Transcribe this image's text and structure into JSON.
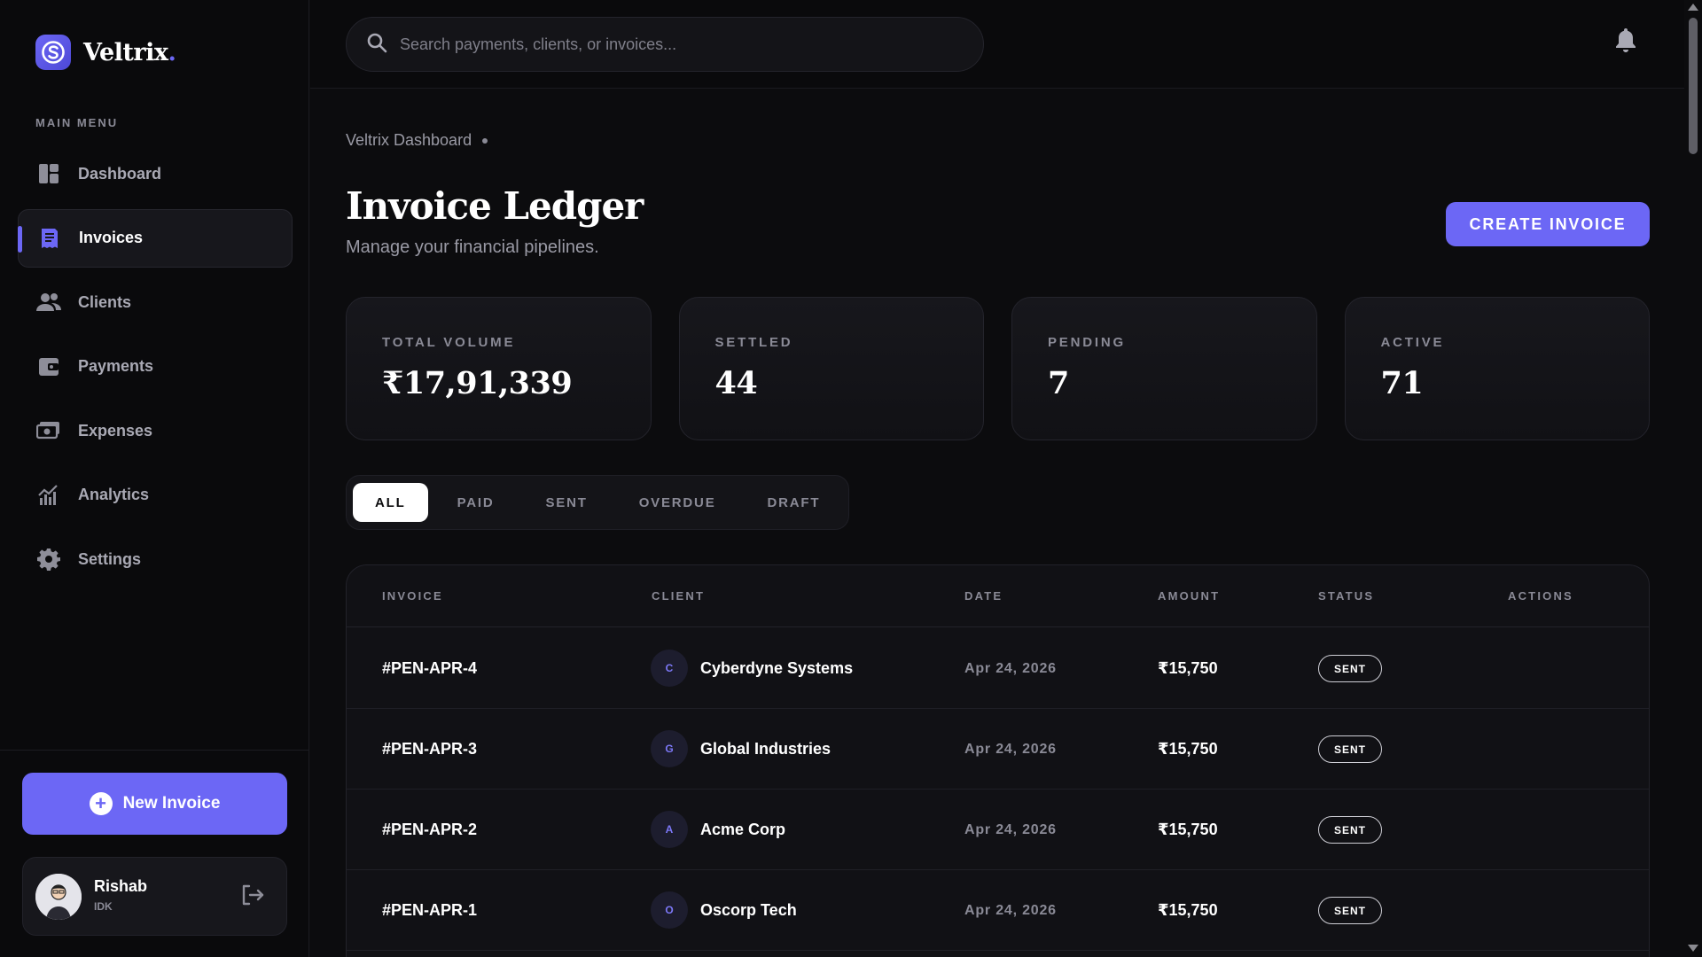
{
  "brand": {
    "name": "Veltrix",
    "dot": "."
  },
  "sidebar": {
    "menu_label": "MAIN MENU",
    "items": [
      {
        "label": "Dashboard",
        "icon": "dashboard-icon"
      },
      {
        "label": "Invoices",
        "icon": "invoice-icon",
        "active": true
      },
      {
        "label": "Clients",
        "icon": "users-icon"
      },
      {
        "label": "Payments",
        "icon": "wallet-icon"
      },
      {
        "label": "Expenses",
        "icon": "cash-icon"
      },
      {
        "label": "Analytics",
        "icon": "analytics-icon"
      },
      {
        "label": "Settings",
        "icon": "gear-icon"
      }
    ],
    "new_invoice_label": "New Invoice",
    "user": {
      "name": "Rishab",
      "subtitle": "IDK"
    }
  },
  "header": {
    "search_placeholder": "Search payments, clients, or invoices..."
  },
  "main": {
    "breadcrumb": "Veltrix Dashboard",
    "title": "Invoice Ledger",
    "subtitle": "Manage your financial pipelines.",
    "create_label": "CREATE INVOICE",
    "stats": [
      {
        "label": "TOTAL VOLUME",
        "value": "₹17,91,339"
      },
      {
        "label": "SETTLED",
        "value": "44"
      },
      {
        "label": "PENDING",
        "value": "7"
      },
      {
        "label": "ACTIVE",
        "value": "71"
      }
    ],
    "tabs": [
      {
        "label": "ALL",
        "active": true
      },
      {
        "label": "PAID"
      },
      {
        "label": "SENT"
      },
      {
        "label": "OVERDUE"
      },
      {
        "label": "DRAFT"
      }
    ],
    "table": {
      "columns": [
        "INVOICE",
        "CLIENT",
        "DATE",
        "AMOUNT",
        "STATUS",
        "ACTIONS"
      ],
      "rows": [
        {
          "invoice": "#PEN-APR-4",
          "initial": "C",
          "client": "Cyberdyne Systems",
          "date": "Apr 24, 2026",
          "amount": "₹15,750",
          "status": "SENT"
        },
        {
          "invoice": "#PEN-APR-3",
          "initial": "G",
          "client": "Global Industries",
          "date": "Apr 24, 2026",
          "amount": "₹15,750",
          "status": "SENT"
        },
        {
          "invoice": "#PEN-APR-2",
          "initial": "A",
          "client": "Acme Corp",
          "date": "Apr 24, 2026",
          "amount": "₹15,750",
          "status": "SENT"
        },
        {
          "invoice": "#PEN-APR-1",
          "initial": "O",
          "client": "Oscorp Tech",
          "date": "Apr 24, 2026",
          "amount": "₹15,750",
          "status": "SENT"
        }
      ]
    }
  },
  "colors": {
    "accent": "#6c67f5",
    "background": "#0c0c0e",
    "card": "#17171c",
    "muted": "#8a8a96"
  }
}
